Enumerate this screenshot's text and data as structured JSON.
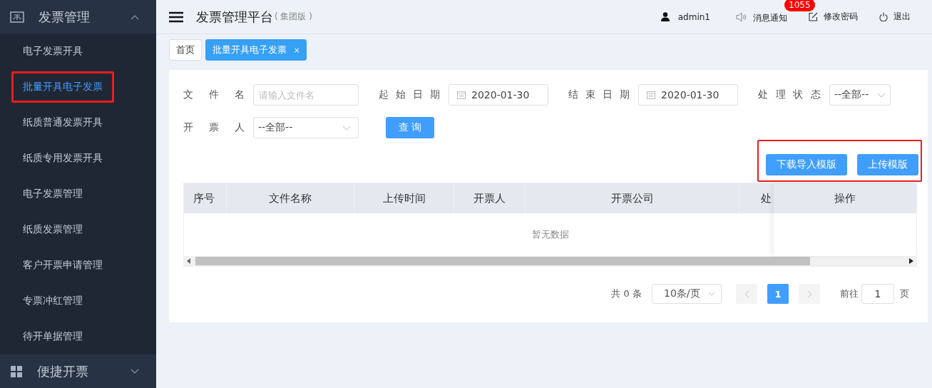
{
  "sidebar": {
    "groups": [
      {
        "title": "发票管理",
        "expanded": true,
        "items": [
          {
            "label": "电子发票开具",
            "selected": false,
            "highlighted": false
          },
          {
            "label": "批量开具电子发票",
            "selected": true,
            "highlighted": true
          },
          {
            "label": "纸质普通发票开具",
            "selected": false,
            "highlighted": false
          },
          {
            "label": "纸质专用发票开具",
            "selected": false,
            "highlighted": false
          },
          {
            "label": "电子发票管理",
            "selected": false,
            "highlighted": false
          },
          {
            "label": "纸质发票管理",
            "selected": false,
            "highlighted": false
          },
          {
            "label": "客户开票申请管理",
            "selected": false,
            "highlighted": false
          },
          {
            "label": "专票冲红管理",
            "selected": false,
            "highlighted": false
          },
          {
            "label": "待开单据管理",
            "selected": false,
            "highlighted": false
          }
        ]
      },
      {
        "title": "便捷开票",
        "expanded": false
      }
    ]
  },
  "header": {
    "title": "发票管理平台",
    "subtitle": "( 集团版 )",
    "user": "admin1",
    "notifications": {
      "label": "消息通知",
      "badge": "1055"
    },
    "change_password": "修改密码",
    "logout": "退出"
  },
  "tabs": [
    {
      "label": "首页",
      "selected": false,
      "closable": false
    },
    {
      "label": "批量开具电子发票",
      "selected": true,
      "closable": true,
      "close": "×"
    }
  ],
  "filters": [
    {
      "kind": "text",
      "label": "文件名",
      "placeholder": "请输入文件名"
    },
    {
      "kind": "date",
      "label": "起始日期",
      "value": "2020-01-30"
    },
    {
      "kind": "date",
      "label": "结束日期",
      "value": "2020-01-30"
    },
    {
      "kind": "select",
      "label": "处理状态",
      "value": "--全部--"
    },
    {
      "kind": "select",
      "label": "开票人",
      "value": "--全部--"
    }
  ],
  "search_button": "查 询",
  "actions": {
    "highlighted": true,
    "buttons": [
      "下载导入模版",
      "上传模版"
    ]
  },
  "table": {
    "columns": [
      "序号",
      "文件名称",
      "上传时间",
      "开票人",
      "开票公司",
      "处"
    ],
    "fixed_column": "操作",
    "empty_text": "暂无数据"
  },
  "pagination": {
    "total": "共 0 条",
    "page_size": "10条/页",
    "pages": [
      {
        "label": "1",
        "selected": true
      }
    ],
    "goto_label": "前往",
    "goto_value": "1",
    "goto_suffix": "页"
  }
}
